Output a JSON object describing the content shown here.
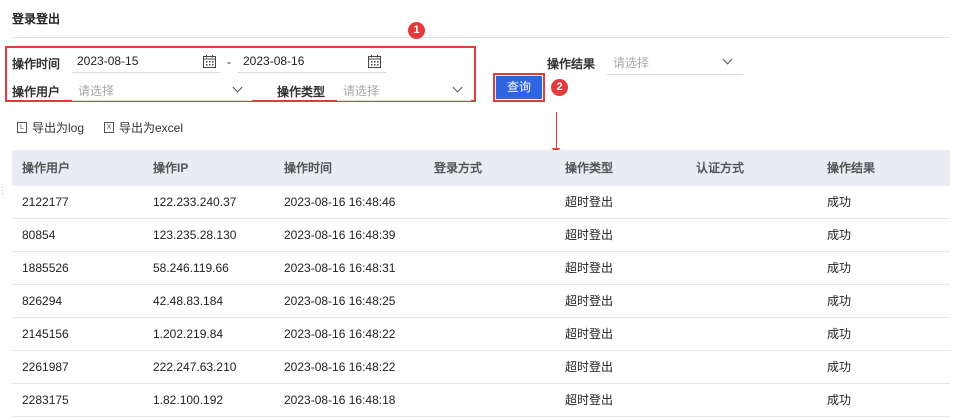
{
  "page_title": "登录登出",
  "filters": {
    "op_time_label": "操作时间",
    "start_date": "2023-08-15",
    "range_sep": "-",
    "end_date": "2023-08-16",
    "op_user_label": "操作用户",
    "op_user_placeholder": "请选择",
    "op_type_label": "操作类型",
    "op_type_placeholder": "请选择",
    "op_result_label": "操作结果",
    "op_result_placeholder": "请选择"
  },
  "query_button": "查询",
  "annotations": {
    "badge1": "1",
    "badge2": "2"
  },
  "exports": {
    "log": "导出为log",
    "excel": "导出为excel",
    "log_glyph": "L",
    "excel_glyph": "X"
  },
  "table": {
    "headers": [
      "操作用户",
      "操作IP",
      "操作时间",
      "登录方式",
      "操作类型",
      "认证方式",
      "操作结果"
    ],
    "rows": [
      [
        "2122177",
        "122.233.240.37",
        "2023-08-16 16:48:46",
        "",
        "超时登出",
        "",
        "成功"
      ],
      [
        "80854",
        "123.235.28.130",
        "2023-08-16 16:48:39",
        "",
        "超时登出",
        "",
        "成功"
      ],
      [
        "1885526",
        "58.246.119.66",
        "2023-08-16 16:48:31",
        "",
        "超时登出",
        "",
        "成功"
      ],
      [
        "826294",
        "42.48.83.184",
        "2023-08-16 16:48:25",
        "",
        "超时登出",
        "",
        "成功"
      ],
      [
        "2145156",
        "1.202.219.84",
        "2023-08-16 16:48:22",
        "",
        "超时登出",
        "",
        "成功"
      ],
      [
        "2261987",
        "222.247.63.210",
        "2023-08-16 16:48:22",
        "",
        "超时登出",
        "",
        "成功"
      ],
      [
        "2283175",
        "1.82.100.192",
        "2023-08-16 16:48:18",
        "",
        "超时登出",
        "",
        "成功"
      ]
    ]
  },
  "colors": {
    "accent": "#2f65e0",
    "annotation": "#e5393b",
    "header_bg": "#e9ecf2"
  },
  "icons": [
    "calendar-icon",
    "chevron-down-icon",
    "export-log-icon",
    "export-excel-icon"
  ]
}
